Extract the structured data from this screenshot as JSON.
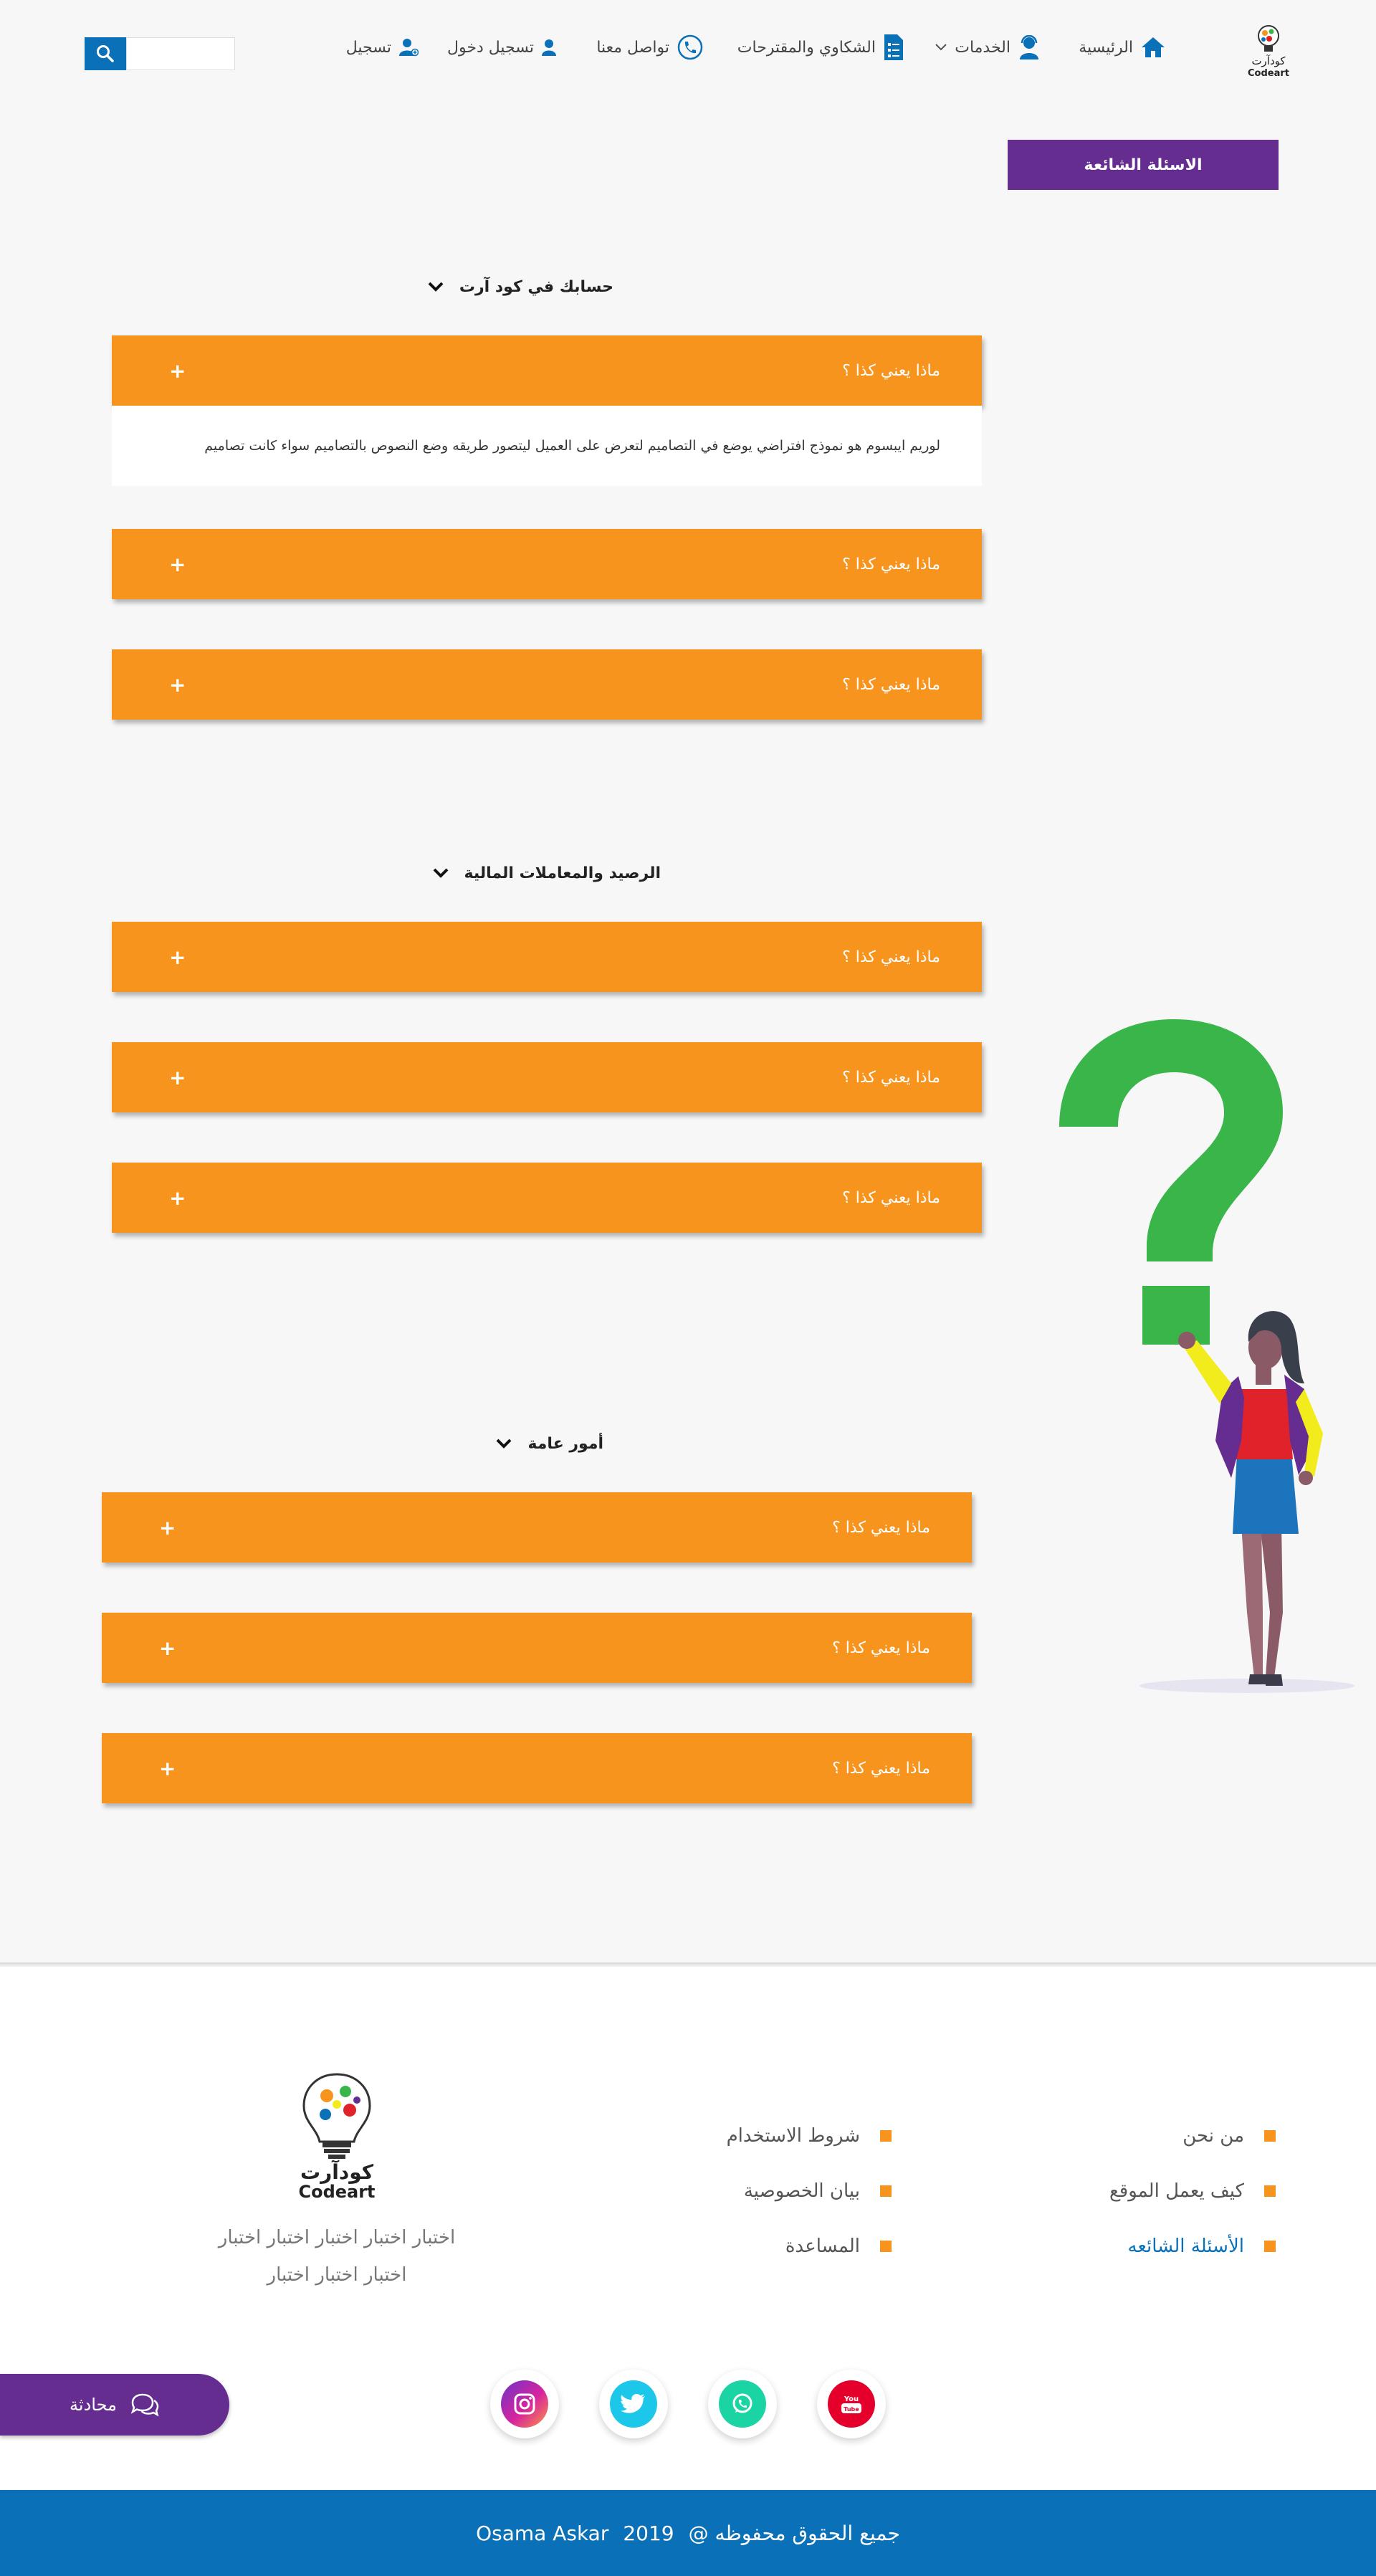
{
  "header": {
    "logo": {
      "text_ar": "كودآرت",
      "text_en": "Codeart"
    },
    "nav": [
      {
        "label": "الرئيسية",
        "icon": "home-icon"
      },
      {
        "label": "الخدمات",
        "icon": "support-agent-icon",
        "has_dropdown": true
      },
      {
        "label": "الشكاوي والمقترحات",
        "icon": "document-icon"
      },
      {
        "label": "تواصل معنا",
        "icon": "phone-icon"
      },
      {
        "label": "تسجيل دخول",
        "icon": "user-icon"
      },
      {
        "label": "تسجيل",
        "icon": "user-add-icon"
      }
    ],
    "search": {
      "placeholder": "",
      "icon": "search-icon"
    }
  },
  "faq_tab": {
    "label": "الاسئلة الشائعة"
  },
  "sections": [
    {
      "title": "حسابك في كود آرت",
      "items": [
        {
          "question": "ماذا يعني كذا ؟",
          "expanded": true,
          "answer": "لوريم ايبسوم هو نموذج افتراضي يوضع في التصاميم لتعرض على العميل ليتصور طريقه وضع النصوص بالتصاميم سواء كانت تصاميم"
        },
        {
          "question": "ماذا يعني كذا ؟"
        },
        {
          "question": "ماذا يعني كذا ؟"
        }
      ]
    },
    {
      "title": "الرصيد والمعاملات المالية",
      "items": [
        {
          "question": "ماذا يعني كذا ؟"
        },
        {
          "question": "ماذا يعني كذا ؟"
        },
        {
          "question": "ماذا يعني كذا ؟"
        }
      ]
    },
    {
      "title": "أمور عامة",
      "items": [
        {
          "question": "ماذا يعني كذا ؟"
        },
        {
          "question": "ماذا يعني كذا ؟"
        },
        {
          "question": "ماذا يعني كذا ؟"
        }
      ]
    }
  ],
  "plus_symbol": "+",
  "footer": {
    "links_col1": [
      "من نحن",
      "كيف يعمل الموقع",
      "الأسئلة الشائعه"
    ],
    "links_col2": [
      "شروط الاستخدام",
      "بيان الخصوصية",
      "المساعدة"
    ],
    "active_link": "الأسئلة الشائعه",
    "description_line1": "اختبار اختبار اختبار اختبار اختبار",
    "description_line2": "اختبار اختبار اختبار",
    "social": [
      "youtube-icon",
      "whatsapp-icon",
      "twitter-icon",
      "instagram-icon"
    ],
    "chat_label": "محادثة",
    "copyright": {
      "text": "جميع الحقوق محفوظه @",
      "year": "2019",
      "name": "Osama Askar"
    }
  },
  "colors": {
    "orange": "#f7941d",
    "purple": "#662d91",
    "blue": "#0a70b8",
    "green": "#39b54a"
  }
}
